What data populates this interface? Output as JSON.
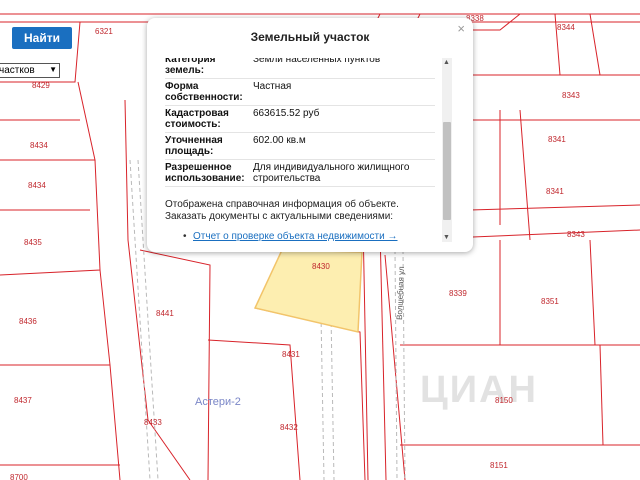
{
  "search": {
    "button_label": "Найти",
    "select_value": "частков"
  },
  "map": {
    "parcels": [
      "6321",
      "8338",
      "8344",
      "8429",
      "8343",
      "8434",
      "8341",
      "8434",
      "8341",
      "8435",
      "8343",
      "8430",
      "8339",
      "8351",
      "8436",
      "8441",
      "8431",
      "8437",
      "8150",
      "8433",
      "8432",
      "8700",
      "8151"
    ],
    "street_name": "Волшебная ул",
    "area_name": "Астери-2",
    "watermark": "ЦИАН"
  },
  "popup": {
    "title": "Земельный участок",
    "close": "×",
    "fields": [
      {
        "key": "Категория земель:",
        "value": "Земли населенных пунктов"
      },
      {
        "key": "Форма собственности:",
        "value": "Частная"
      },
      {
        "key": "Кадастровая стоимость:",
        "value": "663615.52 руб"
      },
      {
        "key": "Уточненная площадь:",
        "value": "602.00 кв.м"
      },
      {
        "key": "Разрешенное использование:",
        "value": "Для индивидуального жилищного строительства"
      }
    ],
    "note": "Отображена справочная информация об объекте. Заказать документы с актуальными сведениями:",
    "report_link": "Отчет о проверке объекта недвижимости →"
  },
  "colors": {
    "parcel_line": "#d8232a",
    "highlight_fill": "#fdeeb0",
    "highlight_stroke": "#f2c46a",
    "button": "#1a6fc0"
  }
}
